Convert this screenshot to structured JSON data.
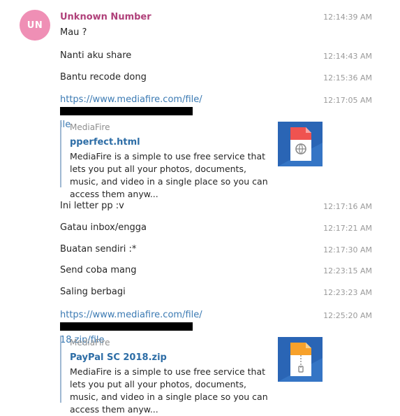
{
  "contact": {
    "avatar_initials": "UN",
    "name": "Unknown Number",
    "avatar_color": "#ef8fb5"
  },
  "messages": [
    {
      "text": "Mau ?",
      "time": "12:14:39 AM"
    },
    {
      "text": "Nanti aku share",
      "time": "12:14:43 AM"
    },
    {
      "text": "Bantu recode dong",
      "time": "12:15:36 AM"
    },
    {
      "link_prefix": "https://www.mediafire.com/file/",
      "link_suffix": "ile",
      "time": "12:17:05 AM"
    },
    {
      "text": "Ini letter pp :v",
      "time": "12:17:16 AM"
    },
    {
      "text": "Gatau inbox/engga",
      "time": "12:17:21 AM"
    },
    {
      "text": "Buatan sendiri :*",
      "time": "12:17:30 AM"
    },
    {
      "text": "Send coba mang",
      "time": "12:23:15 AM"
    },
    {
      "text": "Saling berbagi",
      "time": "12:23:23 AM"
    },
    {
      "link_prefix": "https://www.mediafire.com/file/",
      "link_suffix": "18.zip/file",
      "time": "12:25:20 AM"
    }
  ],
  "previews": [
    {
      "site": "MediaFire",
      "title": "pperfect.html",
      "description": "MediaFire is a simple to use free service that lets you put all your photos, documents, music, and video in a single place so you can access them anyw...",
      "icon": "html-file-icon"
    },
    {
      "site": "MediaFire",
      "title": "PayPal SC 2018.zip",
      "description": "MediaFire is a simple to use free service that lets you put all your photos, documents, music, and video in a single place so you can access them anyw...",
      "icon": "zip-file-icon"
    }
  ],
  "colors": {
    "sender": "#b0417a",
    "link": "#3b7ab3",
    "preview_title": "#2d6da6",
    "thumb_bg": "#2a65b5"
  }
}
